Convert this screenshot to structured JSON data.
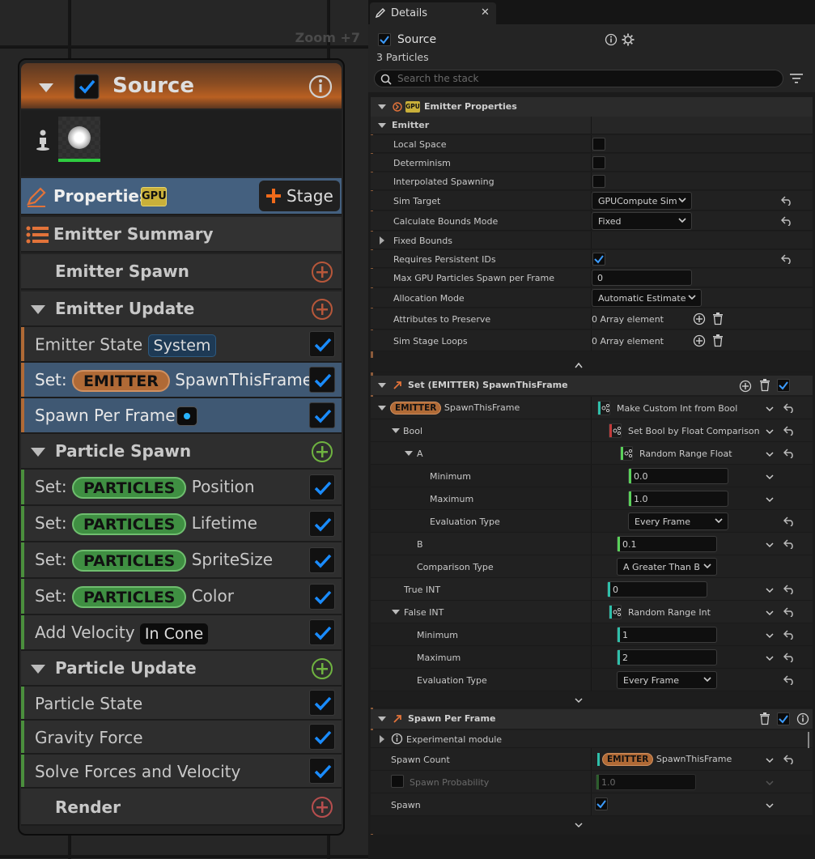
{
  "graph": {
    "zoom_label": "Zoom +7",
    "node": {
      "title": "Source",
      "properties_label": "Properties",
      "gpu_badge": "GPU",
      "stage_button": "Stage",
      "emitter_summary": "Emitter Summary",
      "emitter_spawn": "Emitter Spawn",
      "emitter_update": "Emitter Update",
      "emitter_state": "Emitter State",
      "emitter_state_tag": "System",
      "set_prefix": "Set:",
      "emitter_pill": "EMITTER",
      "spawn_this_frame": "SpawnThisFrame",
      "spawn_per_frame": "Spawn Per Frame",
      "particle_spawn": "Particle Spawn",
      "particles_pill": "PARTICLES",
      "position": "Position",
      "lifetime": "Lifetime",
      "sprite_size": "SpriteSize",
      "color": "Color",
      "add_velocity": "Add Velocity",
      "add_velocity_tag": "In Cone",
      "particle_update": "Particle Update",
      "particle_state": "Particle State",
      "gravity_force": "Gravity Force",
      "solve_forces": "Solve Forces and Velocity",
      "render": "Render"
    },
    "colors": {
      "header_orange": "#b96022",
      "accent_emitter": "#b06a36",
      "accent_particle": "#4b8f3d",
      "checkbox_blue": "#1a8cff"
    }
  },
  "details": {
    "tab_title": "Details",
    "source_name": "Source",
    "particles_count": "3 Particles",
    "search_placeholder": "Search the stack",
    "emitter_properties": {
      "header": "Emitter Properties",
      "gpu_badge": "GPU",
      "group": "Emitter",
      "rows": {
        "local_space": "Local Space",
        "determinism": "Determinism",
        "interpolated_spawning": "Interpolated Spawning",
        "sim_target": "Sim Target",
        "sim_target_value": "GPUCompute Sim",
        "calc_bounds": "Calculate Bounds Mode",
        "calc_bounds_value": "Fixed",
        "fixed_bounds": "Fixed Bounds",
        "requires_ids": "Requires Persistent IDs",
        "max_gpu": "Max GPU Particles Spawn per Frame",
        "max_gpu_value": "0",
        "allocation_mode": "Allocation Mode",
        "allocation_value": "Automatic Estimate",
        "attributes": "Attributes to Preserve",
        "attributes_value": "0 Array element",
        "sim_stage_loops": "Sim Stage Loops",
        "sim_stage_value": "0 Array element"
      }
    },
    "set_module": {
      "header": "Set (EMITTER) SpawnThisFrame",
      "emitter_pill": "EMITTER",
      "spawn_this_frame": "SpawnThisFrame",
      "make_custom": "Make Custom Int from Bool",
      "bool": "Bool",
      "set_bool": "Set Bool by Float Comparison",
      "a": "A",
      "random_range_float": "Random Range Float",
      "minimum": "Minimum",
      "minimum_value": "0.0",
      "maximum": "Maximum",
      "maximum_value": "1.0",
      "evaluation_type": "Evaluation Type",
      "every_frame": "Every Frame",
      "b": "B",
      "b_value": "0.1",
      "comparison_type": "Comparison Type",
      "comparison_value": "A Greater Than B",
      "true_int": "True INT",
      "true_int_value": "0",
      "false_int": "False INT",
      "random_range_int": "Random Range Int",
      "int_min": "Minimum",
      "int_min_value": "1",
      "int_max": "Maximum",
      "int_max_value": "2",
      "int_eval": "Evaluation Type",
      "int_eval_value": "Every Frame"
    },
    "spawn_module": {
      "header": "Spawn Per Frame",
      "experimental": "Experimental module",
      "spawn_count": "Spawn Count",
      "emitter_pill": "EMITTER",
      "spawn_count_value": "SpawnThisFrame",
      "spawn_probability": "Spawn Probability",
      "spawn_probability_value": "1.0",
      "spawn": "Spawn"
    }
  }
}
